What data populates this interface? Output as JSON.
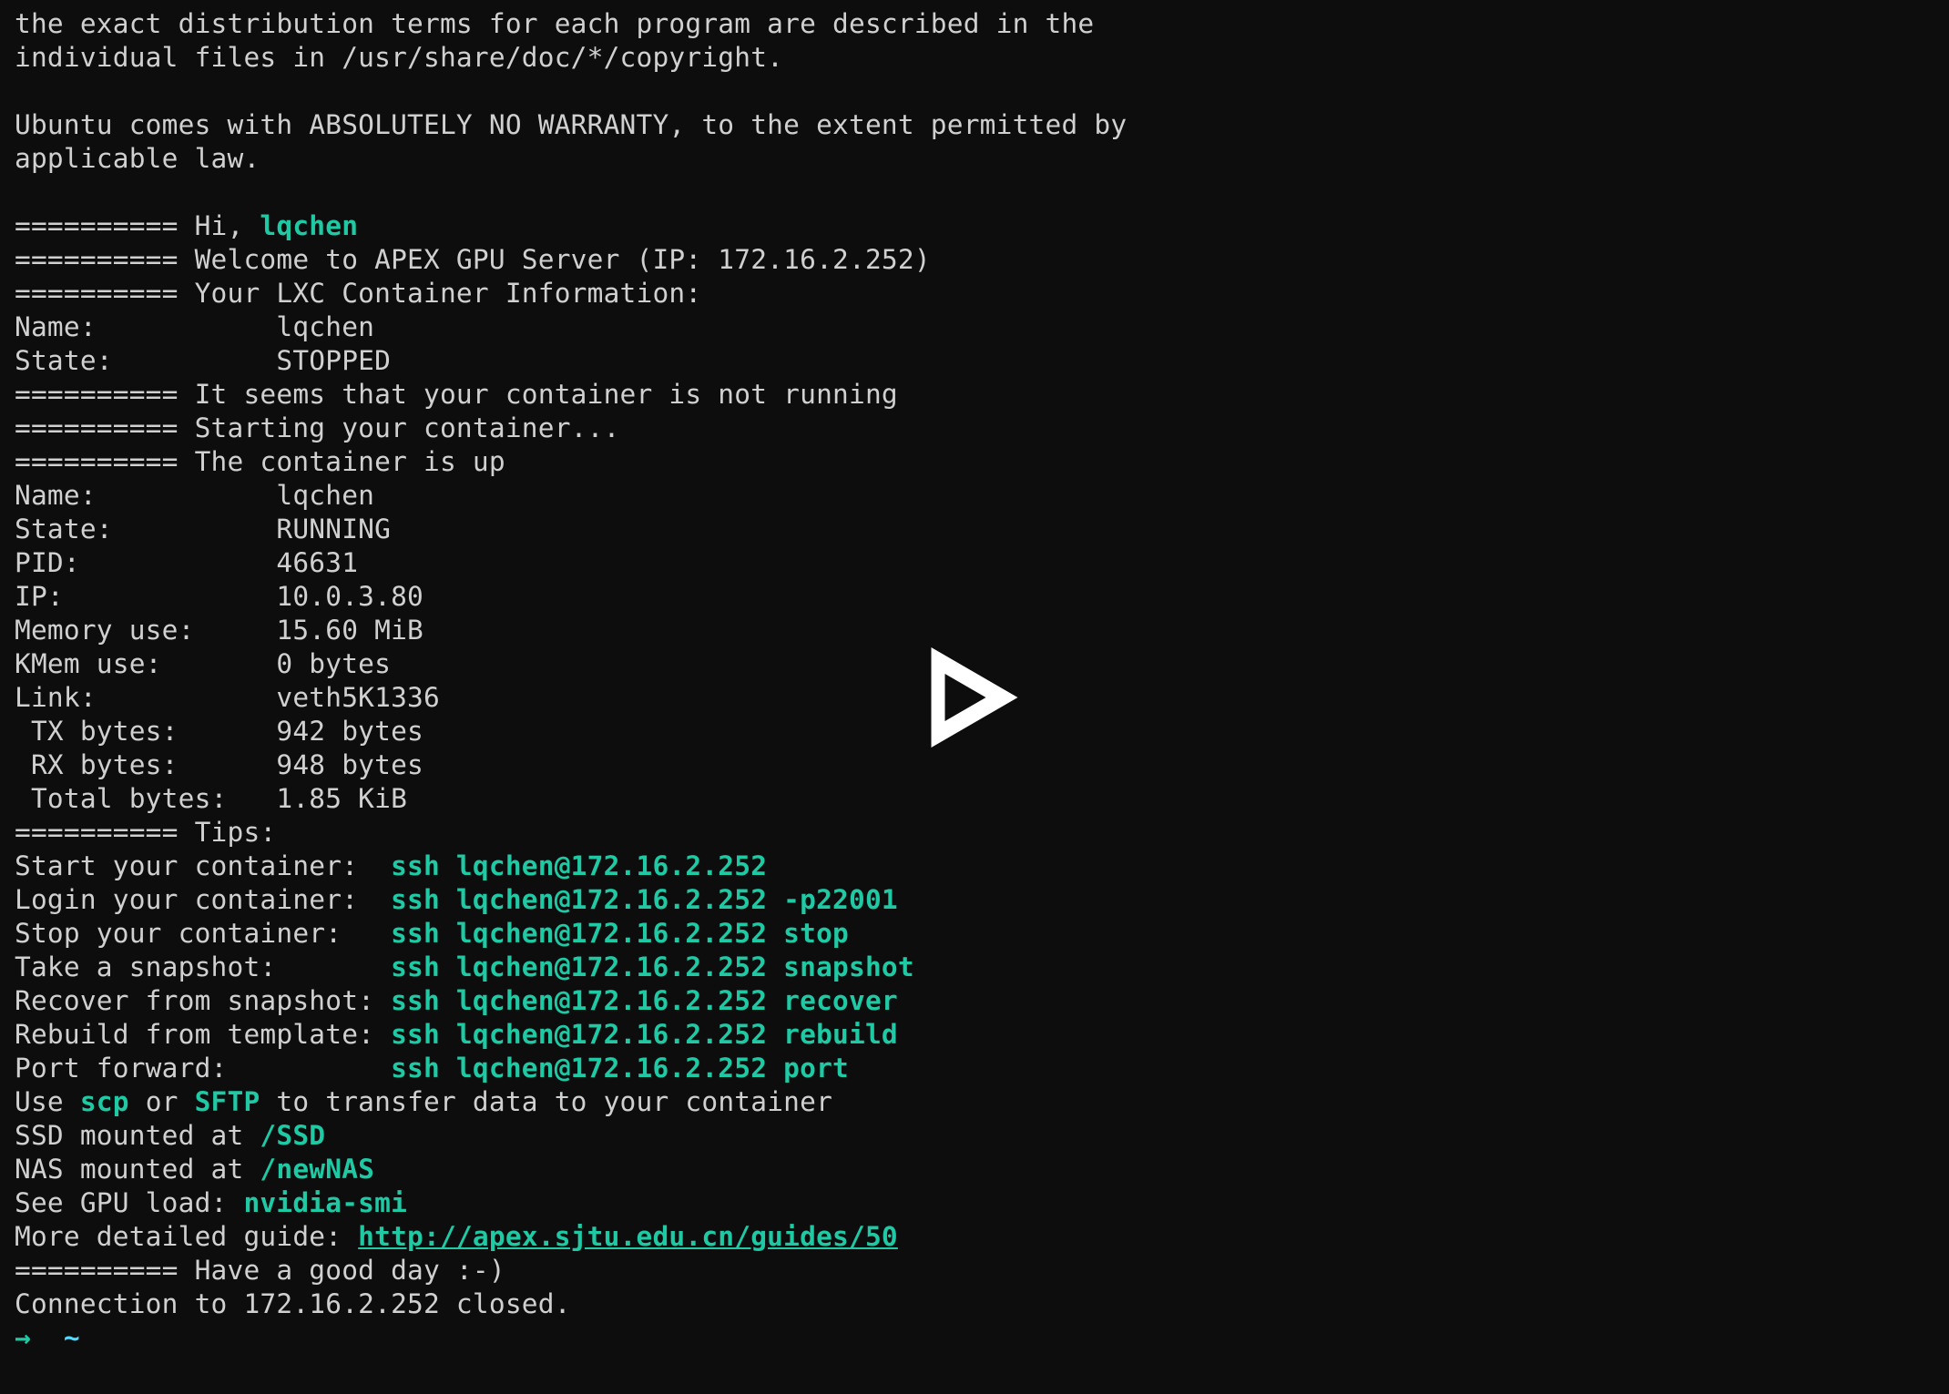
{
  "lines": {
    "l01": "the exact distribution terms for each program are described in the",
    "l02": "individual files in /usr/share/doc/*/copyright.",
    "l03": "",
    "l04": "Ubuntu comes with ABSOLUTELY NO WARRANTY, to the extent permitted by",
    "l05": "applicable law.",
    "l06": "",
    "l07a": "========== Hi, ",
    "l07b": "lqchen",
    "l08": "========== Welcome to APEX GPU Server (IP: 172.16.2.252)",
    "l09": "========== Your LXC Container Information:",
    "l10": "Name:           lqchen",
    "l11": "State:          STOPPED",
    "l12": "========== It seems that your container is not running",
    "l13": "========== Starting your container...",
    "l14": "========== The container is up",
    "l15": "Name:           lqchen",
    "l16": "State:          RUNNING",
    "l17": "PID:            46631",
    "l18": "IP:             10.0.3.80",
    "l19": "Memory use:     15.60 MiB",
    "l20": "KMem use:       0 bytes",
    "l21": "Link:           veth5K1336",
    "l22": " TX bytes:      942 bytes",
    "l23": " RX bytes:      948 bytes",
    "l24": " Total bytes:   1.85 KiB",
    "l25": "========== Tips:",
    "l26a": "Start your container:  ",
    "l26b": "ssh lqchen@172.16.2.252",
    "l27a": "Login your container:  ",
    "l27b": "ssh lqchen@172.16.2.252 -p22001",
    "l28a": "Stop your container:   ",
    "l28b": "ssh lqchen@172.16.2.252 stop",
    "l29a": "Take a snapshot:       ",
    "l29b": "ssh lqchen@172.16.2.252 snapshot",
    "l30a": "Recover from snapshot: ",
    "l30b": "ssh lqchen@172.16.2.252 recover",
    "l31a": "Rebuild from template: ",
    "l31b": "ssh lqchen@172.16.2.252 rebuild",
    "l32a": "Port forward:          ",
    "l32b": "ssh lqchen@172.16.2.252 port",
    "l33a": "Use ",
    "l33b": "scp",
    "l33c": " or ",
    "l33d": "SFTP",
    "l33e": " to transfer data to your container",
    "l34a": "SSD mounted at ",
    "l34b": "/SSD",
    "l35a": "NAS mounted at ",
    "l35b": "/newNAS",
    "l36a": "See GPU load: ",
    "l36b": "nvidia-smi",
    "l37a": "More detailed guide: ",
    "l37b": "http://apex.sjtu.edu.cn/guides/50",
    "l38": "========== Have a good day :-)",
    "l39": "Connection to 172.16.2.252 closed.",
    "prompt_arrow": "→  ",
    "prompt_cwd": "~"
  }
}
